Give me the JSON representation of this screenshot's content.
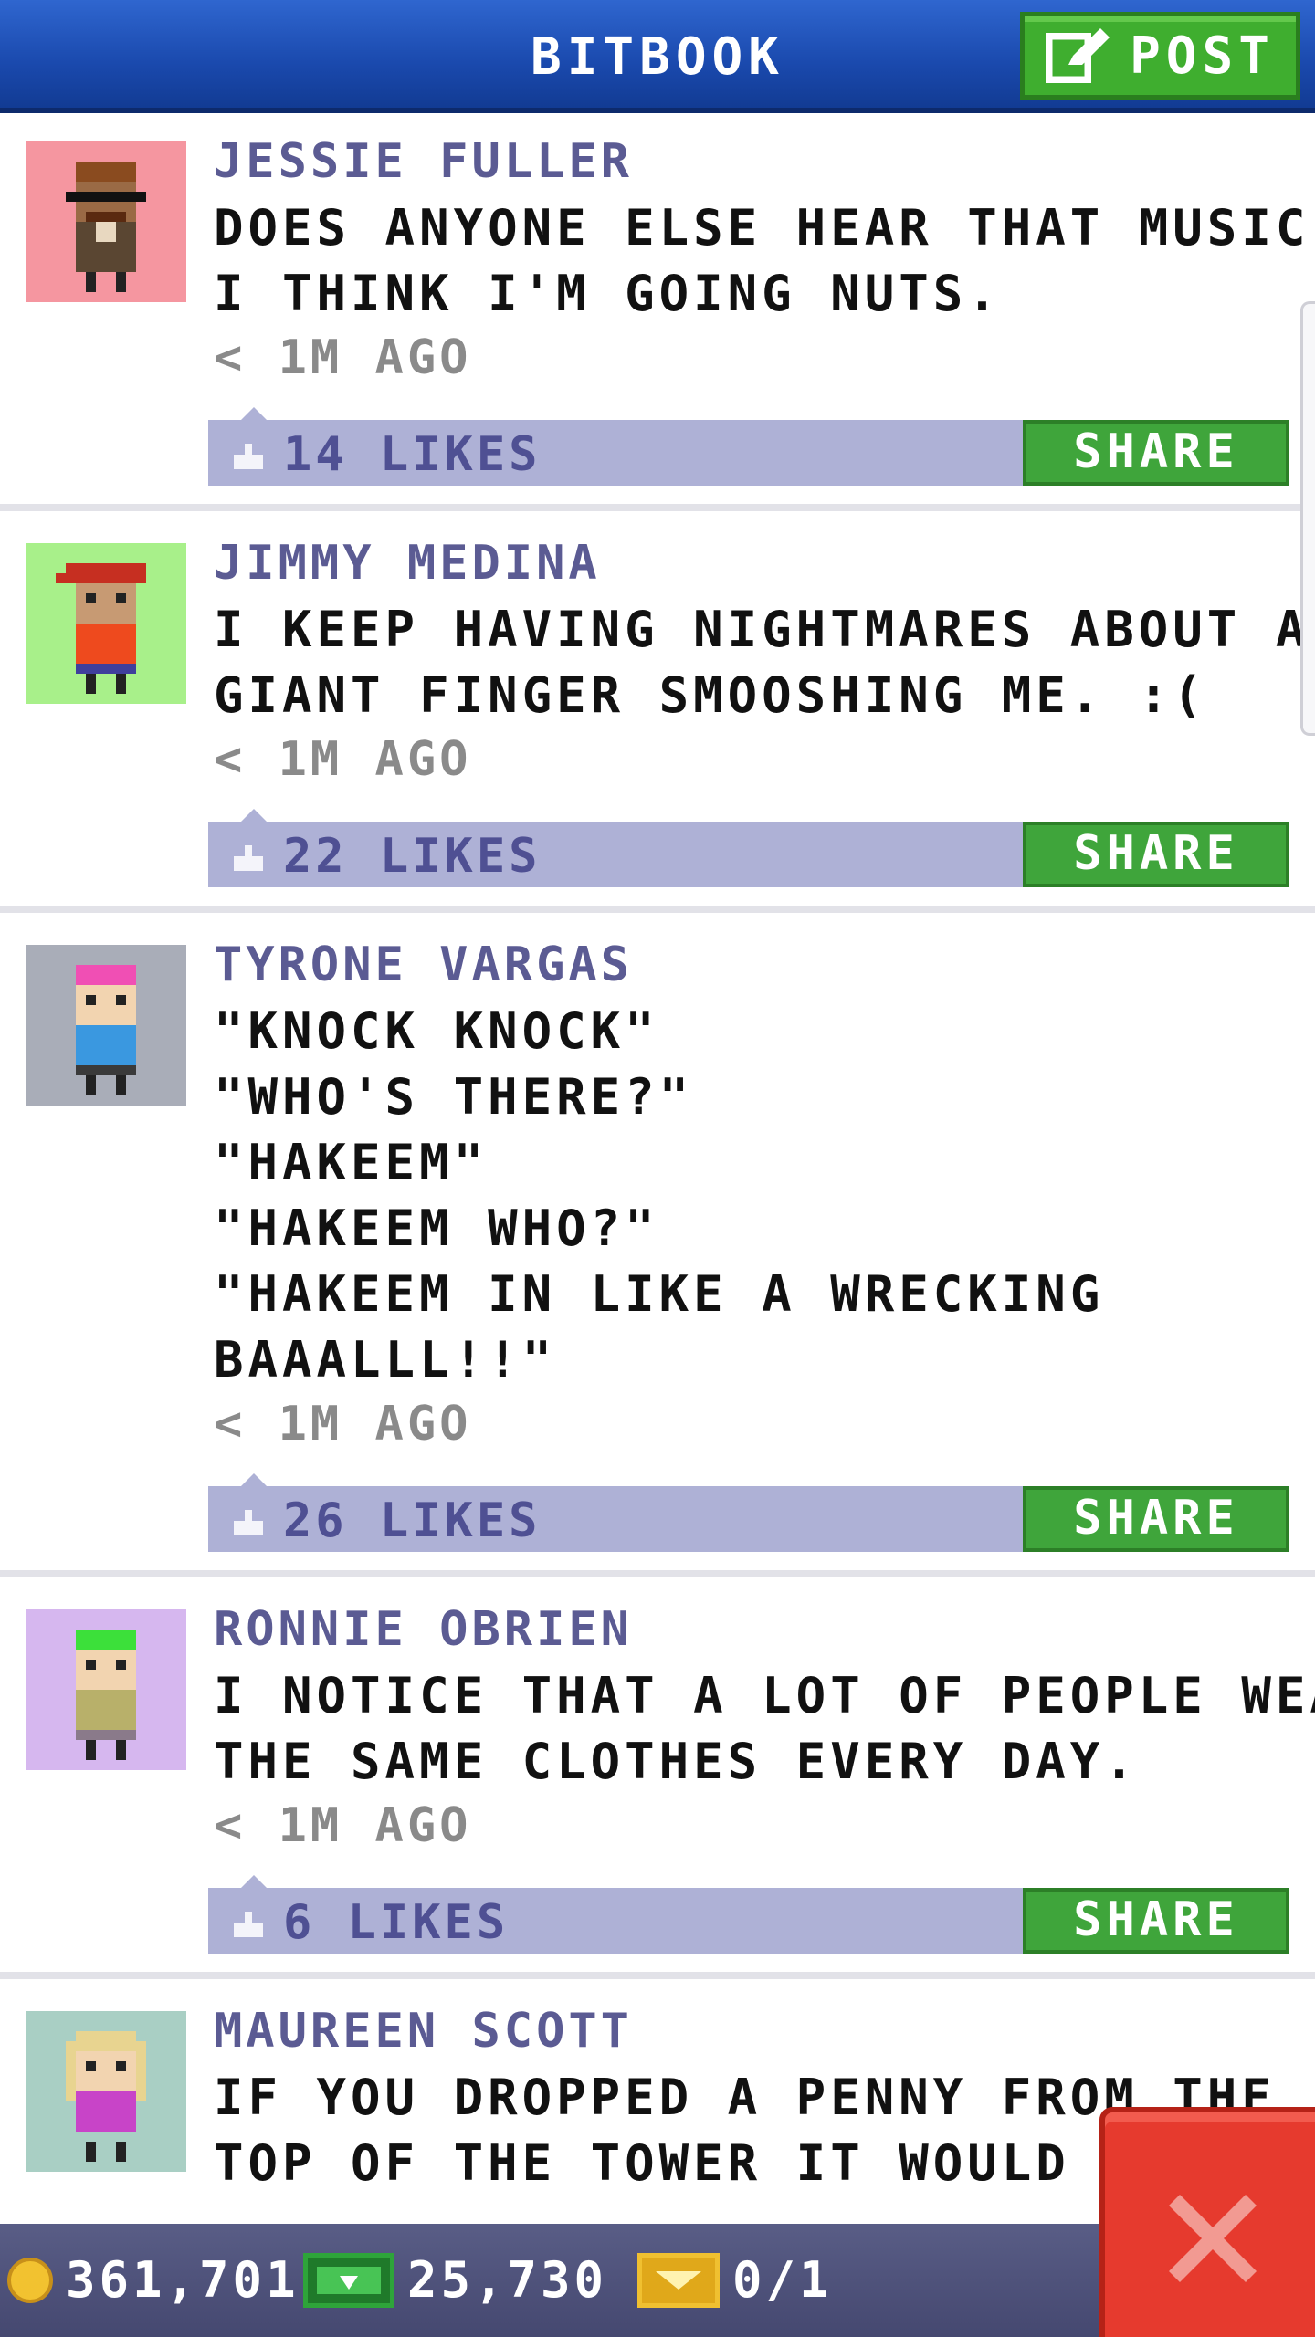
{
  "header": {
    "title": "BITBOOK",
    "post_label": "POST"
  },
  "posts": [
    {
      "name": "JESSIE FULLER",
      "lines": [
        "DOES ANYONE ELSE HEAR THAT MUSIC?",
        "I THINK I'M GOING NUTS."
      ],
      "time": "< 1M AGO",
      "likes": "14 LIKES",
      "share": "SHARE",
      "avatar_bg": "#f596a0"
    },
    {
      "name": "JIMMY MEDINA",
      "lines": [
        "I KEEP HAVING NIGHTMARES ABOUT A",
        "GIANT FINGER SMOOSHING ME. :("
      ],
      "time": "< 1M AGO",
      "likes": "22 LIKES",
      "share": "SHARE",
      "avatar_bg": "#a8f08a"
    },
    {
      "name": "TYRONE VARGAS",
      "lines": [
        "\"KNOCK KNOCK\"",
        "\"WHO'S THERE?\"",
        "\"HAKEEM\"",
        "\"HAKEEM WHO?\"",
        "\"HAKEEM IN LIKE A WRECKING",
        "BAAALLL!!\""
      ],
      "time": "< 1M AGO",
      "likes": "26 LIKES",
      "share": "SHARE",
      "avatar_bg": "#a9adb8"
    },
    {
      "name": "RONNIE OBRIEN",
      "lines": [
        "I NOTICE THAT A LOT OF PEOPLE WEAR",
        "THE SAME CLOTHES EVERY DAY."
      ],
      "time": "< 1M AGO",
      "likes": "6 LIKES",
      "share": "SHARE",
      "avatar_bg": "#d6b7ef"
    },
    {
      "name": "MAUREEN SCOTT",
      "lines": [
        "IF YOU DROPPED A PENNY FROM THE",
        "TOP OF THE TOWER IT WOULD TAKE"
      ],
      "time": "",
      "likes": "",
      "share": "",
      "avatar_bg": "#a9cfc4"
    }
  ],
  "bottom_bar": {
    "coins": "361,701",
    "bux": "25,730",
    "tickets": "0/1"
  },
  "colors": {
    "header_blue": "#1a49ad",
    "post_green": "#3fae2f",
    "likes_bar": "#aeb1d6",
    "name_purple": "#5b5b93",
    "close_red": "#e63a2e"
  },
  "icons": [
    "edit-icon",
    "thumbs-up-icon",
    "coin-icon",
    "bux-icon",
    "vip-ticket-icon",
    "close-icon"
  ]
}
